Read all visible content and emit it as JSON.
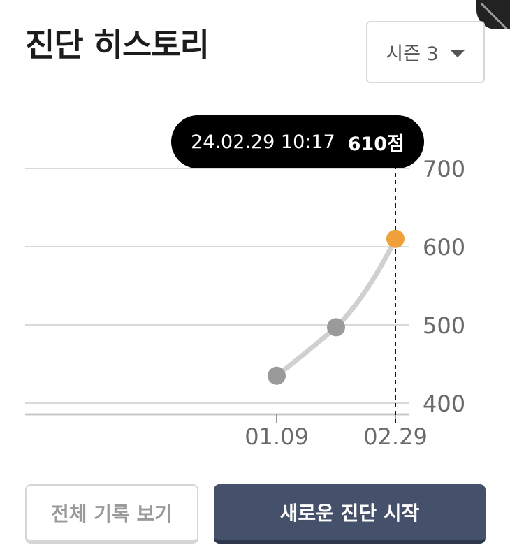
{
  "header": {
    "title": "진단 히스토리",
    "season_select": {
      "selected": "시즌 3"
    }
  },
  "tooltip": {
    "datetime": "24.02.29 10:17",
    "score": "610점"
  },
  "chart_data": {
    "type": "line",
    "x_tick_labels": [
      "01.09",
      "02.29"
    ],
    "y_tick_labels": [
      "700",
      "600",
      "500",
      "400"
    ],
    "ylim": [
      385,
      735
    ],
    "grid": true,
    "points": [
      {
        "x": "01.09",
        "y": 435
      },
      {
        "x": "",
        "y": 497
      },
      {
        "x": "02.29",
        "y": 610
      }
    ],
    "highlighted_index": 2,
    "colors": {
      "line": "#d0d0d0",
      "point": "#9a9a9a",
      "highlight": "#f0a03a",
      "grid": "#d9d9d9",
      "tick_text": "#6a6a6a"
    }
  },
  "buttons": {
    "view_all": "전체 기록 보기",
    "start_new": "새로운 진단 시작"
  }
}
